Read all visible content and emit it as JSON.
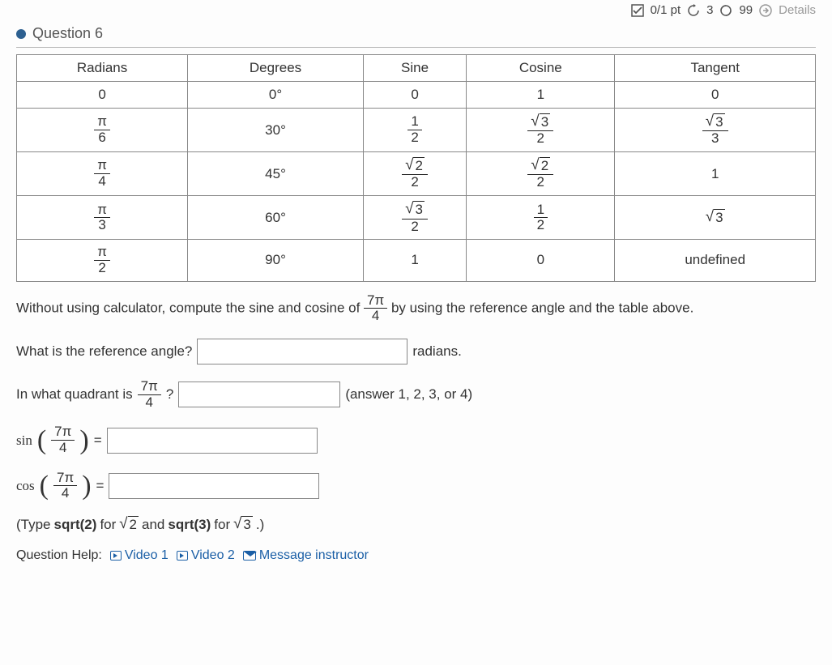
{
  "topbar": {
    "points": "0/1 pt",
    "retry_count": "3",
    "attempts": "99",
    "details": "Details"
  },
  "question": {
    "label": "Question 6"
  },
  "table": {
    "headers": [
      "Radians",
      "Degrees",
      "Sine",
      "Cosine",
      "Tangent"
    ],
    "rows": [
      {
        "rad": "0",
        "deg": "0°",
        "sin": "0",
        "cos": "1",
        "tan": "0"
      },
      {
        "rad_num": "π",
        "rad_den": "6",
        "deg": "30°",
        "sin_num": "1",
        "sin_den": "2",
        "cos_sqrt": "3",
        "cos_den": "2",
        "tan_sqrt": "3",
        "tan_den": "3"
      },
      {
        "rad_num": "π",
        "rad_den": "4",
        "deg": "45°",
        "sin_sqrt": "2",
        "sin_den": "2",
        "cos_sqrt": "2",
        "cos_den": "2",
        "tan": "1"
      },
      {
        "rad_num": "π",
        "rad_den": "3",
        "deg": "60°",
        "sin_sqrt": "3",
        "sin_den": "2",
        "cos_num": "1",
        "cos_den": "2",
        "tan_sqrt": "3"
      },
      {
        "rad_num": "π",
        "rad_den": "2",
        "deg": "90°",
        "sin": "1",
        "cos": "0",
        "tan": "undefined"
      }
    ]
  },
  "prompt": {
    "part1": "Without using calculator, compute the sine and cosine of",
    "angle_num": "7π",
    "angle_den": "4",
    "part2": "by using the reference angle and the table above."
  },
  "q1": {
    "label": "What is the reference angle?",
    "unit": "radians."
  },
  "q2": {
    "label1": "In what quadrant is",
    "angle_num": "7π",
    "angle_den": "4",
    "qmark": "?",
    "hint": "(answer 1, 2, 3, or 4)"
  },
  "q3": {
    "fn": "sin",
    "angle_num": "7π",
    "angle_den": "4",
    "eq": "="
  },
  "q4": {
    "fn": "cos",
    "angle_num": "7π",
    "angle_den": "4",
    "eq": "="
  },
  "hint": {
    "text1": "(Type",
    "code1": "sqrt(2)",
    "text2": "for",
    "sqrt1": "2",
    "text3": "and",
    "code2": "sqrt(3)",
    "text4": "for",
    "sqrt2": "3",
    "text5": ".)"
  },
  "help": {
    "label": "Question Help:",
    "video1": "Video 1",
    "video2": "Video 2",
    "message": "Message instructor"
  }
}
